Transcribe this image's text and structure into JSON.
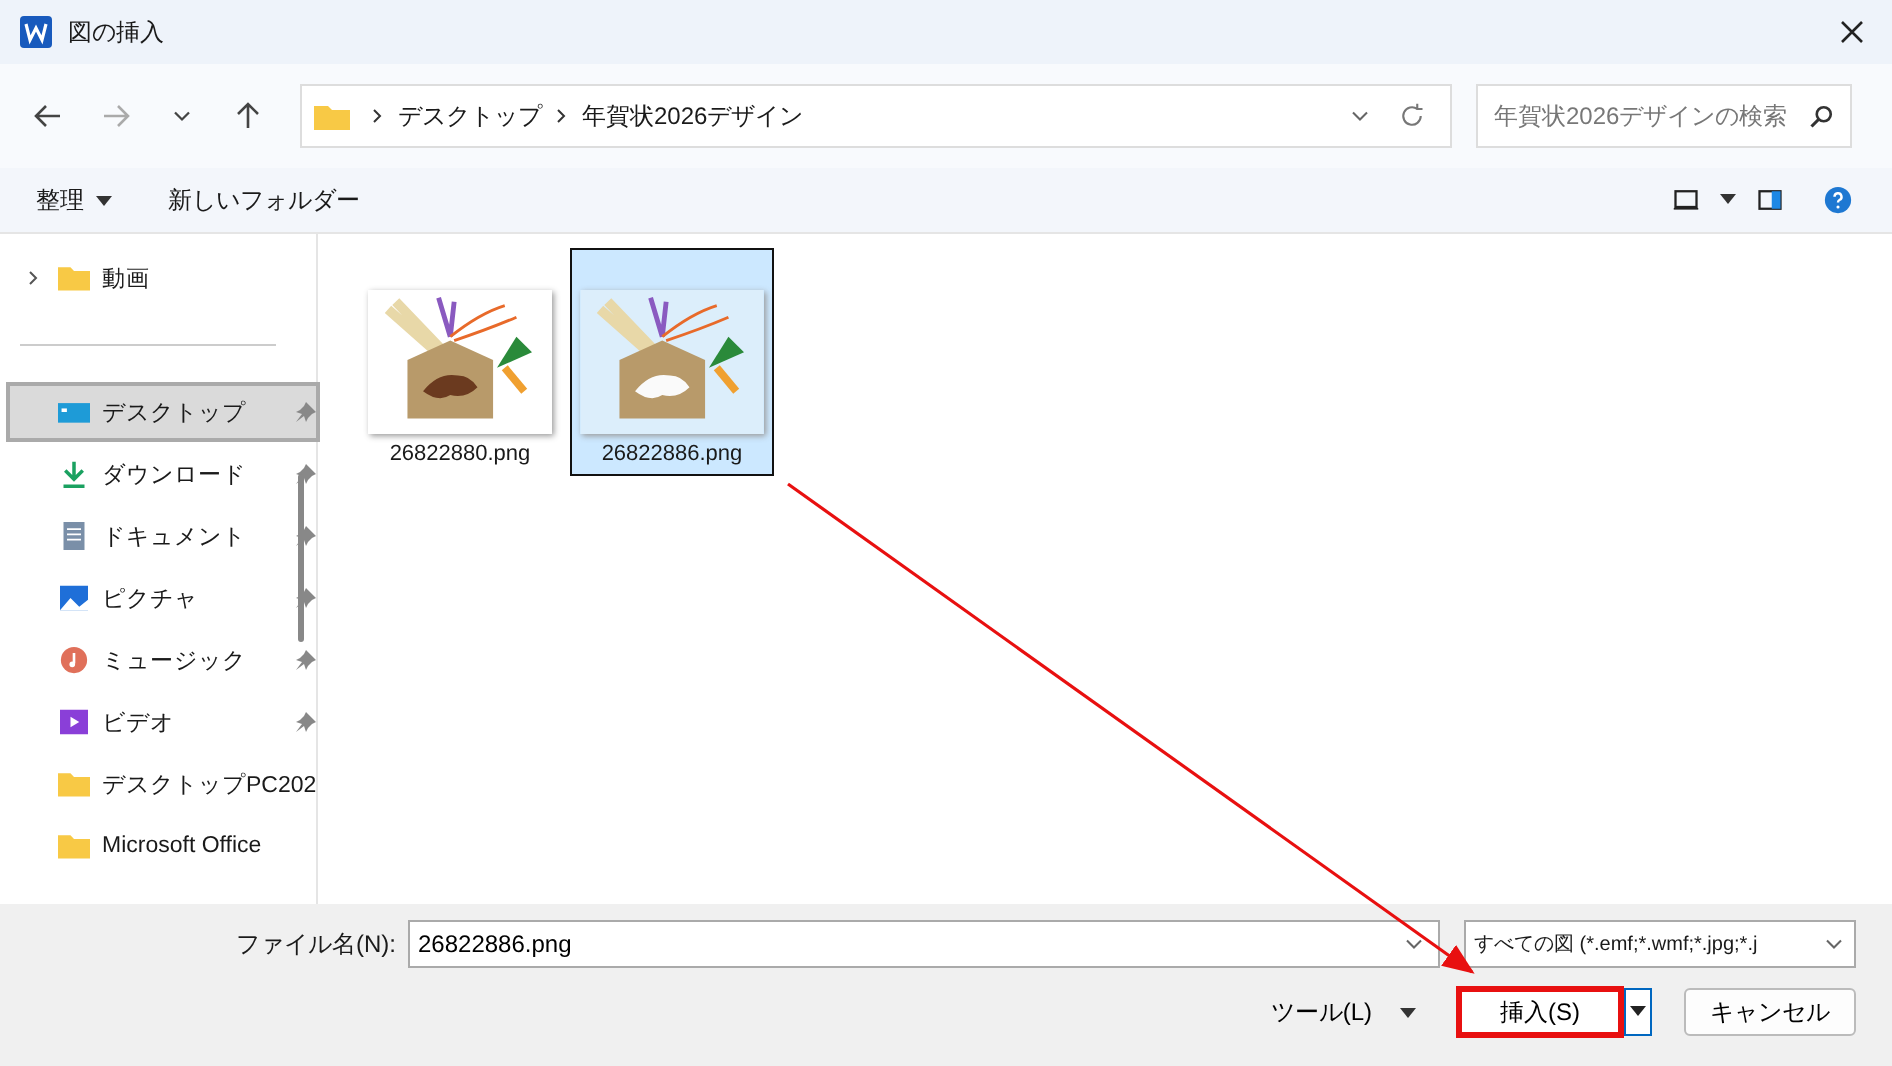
{
  "window": {
    "title": "図の挿入"
  },
  "address_bar": {
    "path": [
      "デスクトップ",
      "年賀状2026デザイン"
    ]
  },
  "search": {
    "placeholder": "年賀状2026デザインの検索"
  },
  "toolbar": {
    "organize": "整理",
    "new_folder": "新しいフォルダー"
  },
  "sidebar": {
    "items": [
      {
        "label": "動画",
        "kind": "folder",
        "expandable": true,
        "pinned": false,
        "selected": false
      },
      {
        "label": "デスクトップ",
        "kind": "desktop",
        "expandable": false,
        "pinned": true,
        "selected": true
      },
      {
        "label": "ダウンロード",
        "kind": "download",
        "expandable": false,
        "pinned": true,
        "selected": false
      },
      {
        "label": "ドキュメント",
        "kind": "document",
        "expandable": false,
        "pinned": true,
        "selected": false
      },
      {
        "label": "ピクチャ",
        "kind": "picture",
        "expandable": false,
        "pinned": true,
        "selected": false
      },
      {
        "label": "ミュージック",
        "kind": "music",
        "expandable": false,
        "pinned": true,
        "selected": false
      },
      {
        "label": "ビデオ",
        "kind": "video",
        "expandable": false,
        "pinned": true,
        "selected": false
      },
      {
        "label": "デスクトップPC202",
        "kind": "folder",
        "expandable": false,
        "pinned": false,
        "selected": false
      },
      {
        "label": "Microsoft Office",
        "kind": "folder",
        "expandable": false,
        "pinned": false,
        "selected": false
      }
    ]
  },
  "files": [
    {
      "name": "26822880.png",
      "selected": false
    },
    {
      "name": "26822886.png",
      "selected": true
    }
  ],
  "footer": {
    "file_name_label": "ファイル名(N):",
    "file_name": "26822886.png",
    "file_type": "すべての図 (*.emf;*.wmf;*.jpg;*.j",
    "tools": "ツール(L)",
    "insert": "挿入(S)",
    "insert_highlighted": true,
    "cancel": "キャンセル"
  }
}
